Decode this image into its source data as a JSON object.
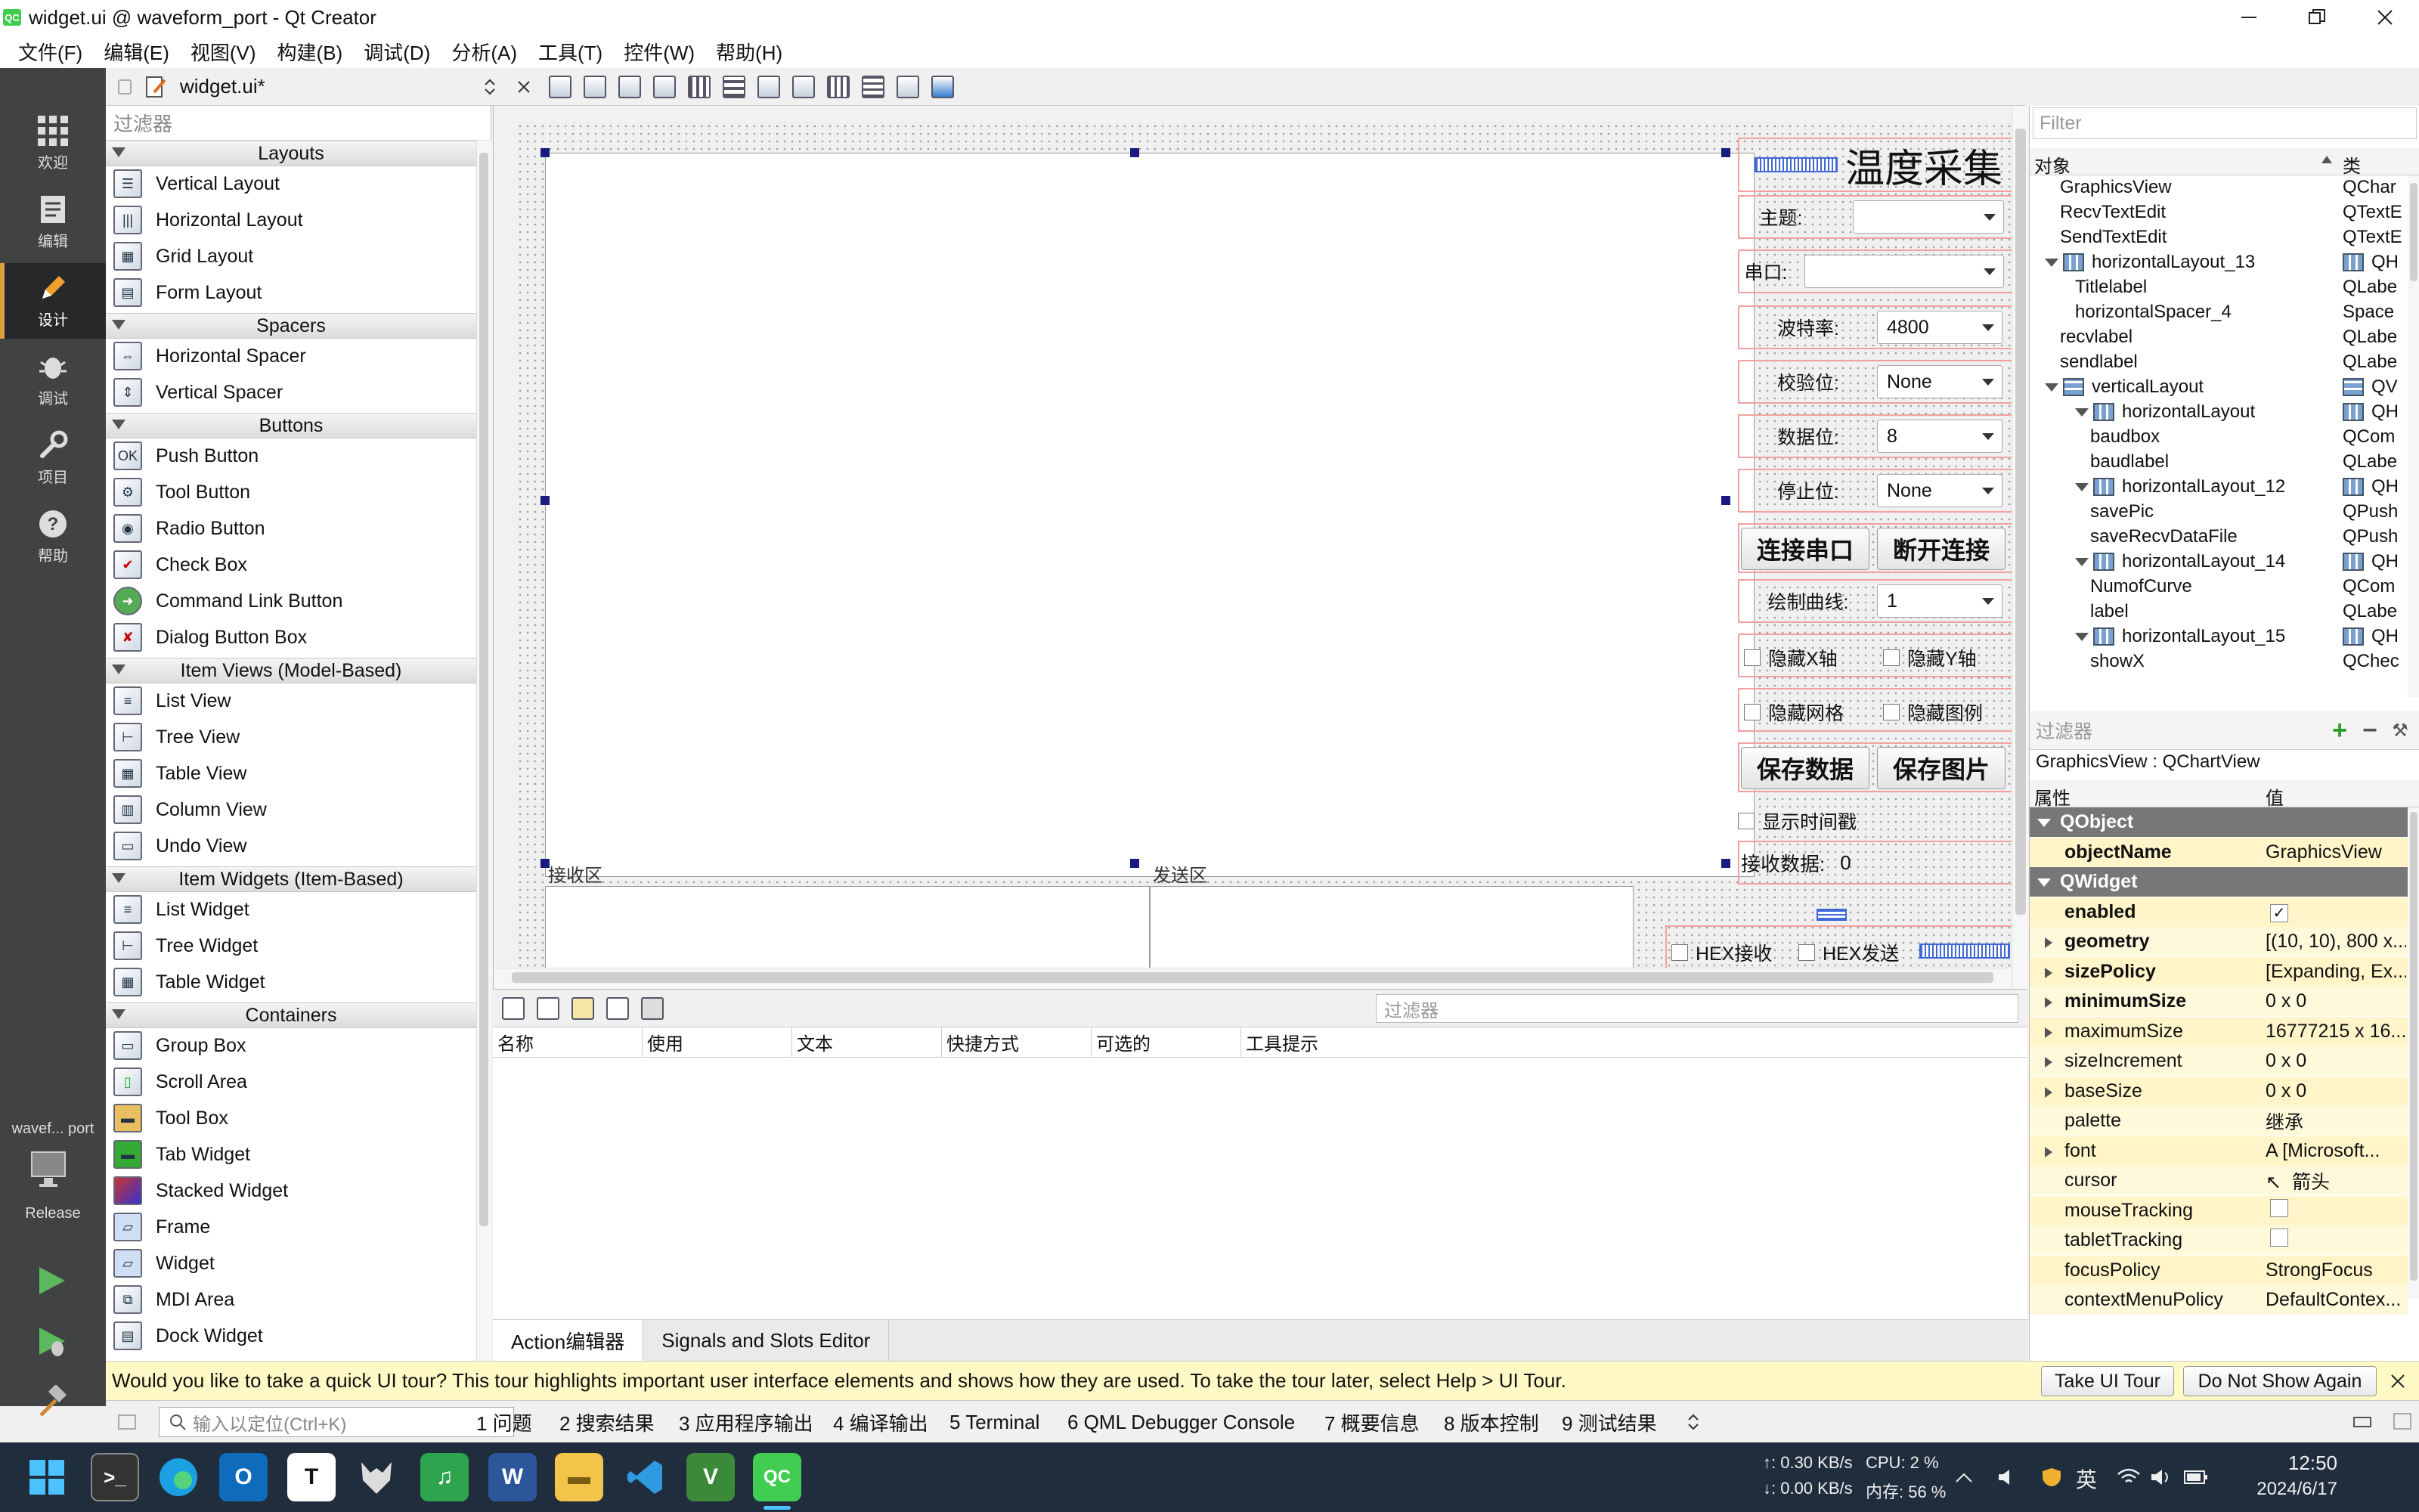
{
  "window": {
    "title": "widget.ui @ waveform_port - Qt Creator",
    "app_badge": "QC"
  },
  "menu": [
    "文件(F)",
    "编辑(E)",
    "视图(V)",
    "构建(B)",
    "调试(D)",
    "分析(A)",
    "工具(T)",
    "控件(W)",
    "帮助(H)"
  ],
  "modes": {
    "welcome": "欢迎",
    "edit": "编辑",
    "design": "设计",
    "debug": "调试",
    "projects": "项目",
    "help": "帮助",
    "kit_project": "wavef... port",
    "kit_build": "Release"
  },
  "editor": {
    "file_tab": "widget.ui*"
  },
  "widget_box": {
    "filter_placeholder": "过滤器",
    "cats": {
      "layouts": "Layouts",
      "spacers": "Spacers",
      "buttons": "Buttons",
      "item_views": "Item Views (Model-Based)",
      "item_widgets": "Item Widgets (Item-Based)",
      "containers": "Containers"
    },
    "items": {
      "vertical_layout": "Vertical Layout",
      "horizontal_layout": "Horizontal Layout",
      "grid_layout": "Grid Layout",
      "form_layout": "Form Layout",
      "horizontal_spacer": "Horizontal Spacer",
      "vertical_spacer": "Vertical Spacer",
      "push_button": "Push Button",
      "tool_button": "Tool Button",
      "radio_button": "Radio Button",
      "check_box": "Check Box",
      "command_link_button": "Command Link Button",
      "dialog_button_box": "Dialog Button Box",
      "list_view": "List View",
      "tree_view": "Tree View",
      "table_view": "Table View",
      "column_view": "Column View",
      "undo_view": "Undo View",
      "list_widget": "List Widget",
      "tree_widget": "Tree Widget",
      "table_widget": "Table Widget",
      "group_box": "Group Box",
      "scroll_area": "Scroll Area",
      "tool_box": "Tool Box",
      "tab_widget": "Tab Widget",
      "stacked_widget": "Stacked Widget",
      "frame": "Frame",
      "widget": "Widget",
      "mdi_area": "MDI Area",
      "dock_widget": "Dock Widget"
    }
  },
  "form": {
    "title": "温度采集",
    "theme_label": "主题:",
    "port_label": "串口:",
    "baud_label": "波特率:",
    "baud_value": "4800",
    "parity_label": "校验位:",
    "parity_value": "None",
    "databits_label": "数据位:",
    "databits_value": "8",
    "stopbits_label": "停止位:",
    "stopbits_value": "None",
    "connect_btn": "连接串口",
    "disconnect_btn": "断开连接",
    "curve_label": "绘制曲线:",
    "curve_value": "1",
    "hide_x": "隐藏X轴",
    "hide_y": "隐藏Y轴",
    "hide_grid": "隐藏网格",
    "hide_legend": "隐藏图例",
    "save_data_btn": "保存数据",
    "save_pic_btn": "保存图片",
    "show_time": "显示时间戳",
    "recv_count_label": "接收数据:",
    "recv_count_value": "0",
    "recv_area": "接收区",
    "send_area": "发送区",
    "hex_recv": "HEX接收",
    "hex_send": "HEX发送"
  },
  "action_editor": {
    "filter_placeholder": "过滤器",
    "columns": [
      "名称",
      "使用",
      "文本",
      "快捷方式",
      "可选的",
      "工具提示"
    ],
    "tabs": [
      "Action编辑器",
      "Signals and Slots Editor"
    ]
  },
  "object_inspector": {
    "filter_placeholder": "Filter",
    "col_object": "对象",
    "col_class": "类",
    "rows": [
      {
        "name": "GraphicsView",
        "cls": "QChar",
        "level": 1,
        "layout": false,
        "exp": false
      },
      {
        "name": "RecvTextEdit",
        "cls": "QTextE",
        "level": 1,
        "layout": false,
        "exp": false
      },
      {
        "name": "SendTextEdit",
        "cls": "QTextE",
        "level": 1,
        "layout": false,
        "exp": false
      },
      {
        "name": "horizontalLayout_13",
        "cls": "QH",
        "level": 1,
        "layout": true,
        "exp": true
      },
      {
        "name": "Titlelabel",
        "cls": "QLabe",
        "level": 2,
        "layout": false,
        "exp": false
      },
      {
        "name": "horizontalSpacer_4",
        "cls": "Space",
        "level": 2,
        "layout": false,
        "exp": false
      },
      {
        "name": "recvlabel",
        "cls": "QLabe",
        "level": 1,
        "layout": false,
        "exp": false
      },
      {
        "name": "sendlabel",
        "cls": "QLabe",
        "level": 1,
        "layout": false,
        "exp": false
      },
      {
        "name": "verticalLayout",
        "cls": "QV",
        "level": 1,
        "layout": true,
        "exp": true
      },
      {
        "name": "horizontalLayout",
        "cls": "QH",
        "level": 2,
        "layout": true,
        "exp": true
      },
      {
        "name": "baudbox",
        "cls": "QCom",
        "level": 3,
        "layout": false,
        "exp": false
      },
      {
        "name": "baudlabel",
        "cls": "QLabe",
        "level": 3,
        "layout": false,
        "exp": false
      },
      {
        "name": "horizontalLayout_12",
        "cls": "QH",
        "level": 2,
        "layout": true,
        "exp": true
      },
      {
        "name": "savePic",
        "cls": "QPush",
        "level": 3,
        "layout": false,
        "exp": false
      },
      {
        "name": "saveRecvDataFile",
        "cls": "QPush",
        "level": 3,
        "layout": false,
        "exp": false
      },
      {
        "name": "horizontalLayout_14",
        "cls": "QH",
        "level": 2,
        "layout": true,
        "exp": true
      },
      {
        "name": "NumofCurve",
        "cls": "QCom",
        "level": 3,
        "layout": false,
        "exp": false
      },
      {
        "name": "label",
        "cls": "QLabe",
        "level": 3,
        "layout": false,
        "exp": false
      },
      {
        "name": "horizontalLayout_15",
        "cls": "QH",
        "level": 2,
        "layout": true,
        "exp": true
      },
      {
        "name": "showX",
        "cls": "QChec",
        "level": 3,
        "layout": false,
        "exp": false
      }
    ]
  },
  "property_editor": {
    "filter_placeholder": "过滤器",
    "object_line": "GraphicsView : QChartView",
    "col_property": "属性",
    "col_value": "值",
    "rows": [
      {
        "name": "QObject",
        "value": "",
        "kind": "grp"
      },
      {
        "name": "objectName",
        "value": "GraphicsView",
        "kind": "y",
        "bold": true
      },
      {
        "name": "QWidget",
        "value": "",
        "kind": "grp"
      },
      {
        "name": "enabled",
        "value": "✓",
        "kind": "y",
        "bold": true,
        "check": true
      },
      {
        "name": "geometry",
        "value": "[(10, 10), 800 x...",
        "kind": "y2",
        "bold": true,
        "exp": true
      },
      {
        "name": "sizePolicy",
        "value": "[Expanding, Ex...",
        "kind": "y",
        "bold": true,
        "exp": true
      },
      {
        "name": "minimumSize",
        "value": "0 x 0",
        "kind": "y2",
        "bold": true,
        "exp": true
      },
      {
        "name": "maximumSize",
        "value": "16777215 x 16...",
        "kind": "y",
        "exp": true
      },
      {
        "name": "sizeIncrement",
        "value": "0 x 0",
        "kind": "y2",
        "exp": true
      },
      {
        "name": "baseSize",
        "value": "0 x 0",
        "kind": "y",
        "exp": true
      },
      {
        "name": "palette",
        "value": "继承",
        "kind": "y2"
      },
      {
        "name": "font",
        "value": "A  [Microsoft...",
        "kind": "y",
        "exp": true
      },
      {
        "name": "cursor",
        "value": "箭头",
        "kind": "y2",
        "cursor": true
      },
      {
        "name": "mouseTracking",
        "value": "",
        "kind": "y",
        "check": true
      },
      {
        "name": "tabletTracking",
        "value": "",
        "kind": "y2",
        "check": true
      },
      {
        "name": "focusPolicy",
        "value": "StrongFocus",
        "kind": "y"
      },
      {
        "name": "contextMenuPolicy",
        "value": "DefaultContex...",
        "kind": "y2"
      }
    ]
  },
  "tour": {
    "message": "Would you like to take a quick UI tour? This tour highlights important user interface elements and shows how they are used. To take the tour later, select Help > UI Tour.",
    "take_btn": "Take UI Tour",
    "dismiss_btn": "Do Not Show Again"
  },
  "output_bar": {
    "locator_placeholder": "输入以定位(Ctrl+K)",
    "tabs": [
      "1  问题",
      "2  搜索结果",
      "3  应用程序输出",
      "4  编译输出",
      "5  Terminal",
      "6  QML Debugger Console",
      "7  概要信息",
      "8  版本控制",
      "9  测试结果"
    ]
  },
  "taskbar": {
    "net_up": "↑: 0.30 KB/s",
    "net_down": "↓: 0.00 KB/s",
    "cpu": "CPU: 2 %",
    "mem": "内存: 56 %",
    "ime": "英",
    "time": "12:50",
    "date": "2024/6/17"
  }
}
